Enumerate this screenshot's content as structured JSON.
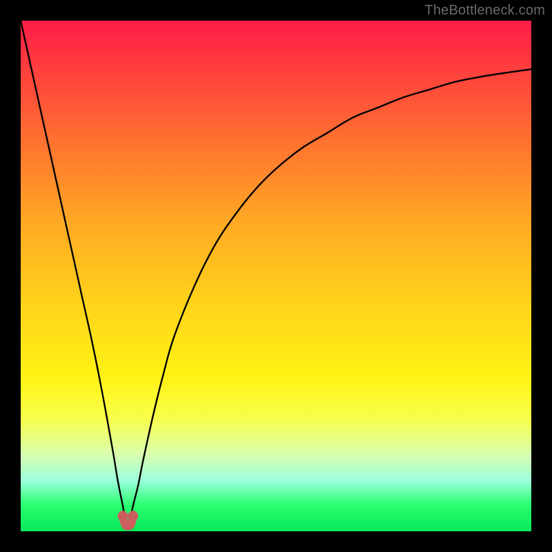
{
  "watermark_text": "TheBottleneck.com",
  "colors": {
    "frame": "#000000",
    "curve": "#000000",
    "marker": "#cb5f5e",
    "gradient_top": "#ff1d47",
    "gradient_mid_orange": "#ffa724",
    "gradient_yellow": "#fff314",
    "gradient_green": "#06e85a"
  },
  "chart_data": {
    "type": "line",
    "title": "",
    "xlabel": "",
    "ylabel": "",
    "xlim": [
      0,
      100
    ],
    "ylim": [
      0,
      100
    ],
    "grid": false,
    "legend": false,
    "series": [
      {
        "name": "bottleneck-curve",
        "x": [
          0,
          2,
          4,
          6,
          8,
          10,
          12,
          14,
          16,
          18,
          19,
          20,
          20.5,
          21,
          21.5,
          22,
          23,
          24,
          26,
          28,
          30,
          34,
          38,
          42,
          46,
          50,
          55,
          60,
          65,
          70,
          75,
          80,
          85,
          90,
          95,
          100
        ],
        "y": [
          100,
          91,
          82,
          73,
          64,
          55,
          46,
          37,
          27,
          16,
          10,
          5,
          2.5,
          1.5,
          2.5,
          5,
          9,
          14,
          23,
          31,
          38,
          48,
          56,
          62,
          67,
          71,
          75,
          78,
          81,
          83,
          85,
          86.5,
          88,
          89,
          89.8,
          90.5
        ]
      }
    ],
    "markers": [
      {
        "name": "valley-left-dot",
        "x": 20,
        "y": 3.0
      },
      {
        "name": "valley-right-dot",
        "x": 22,
        "y": 3.0
      },
      {
        "name": "valley-bottom-link",
        "path_x": [
          20,
          20.4,
          21,
          21.6,
          22
        ],
        "path_y": [
          3.0,
          1.4,
          1.0,
          1.4,
          3.0
        ]
      }
    ],
    "marker_color": "#cb5f5e"
  }
}
